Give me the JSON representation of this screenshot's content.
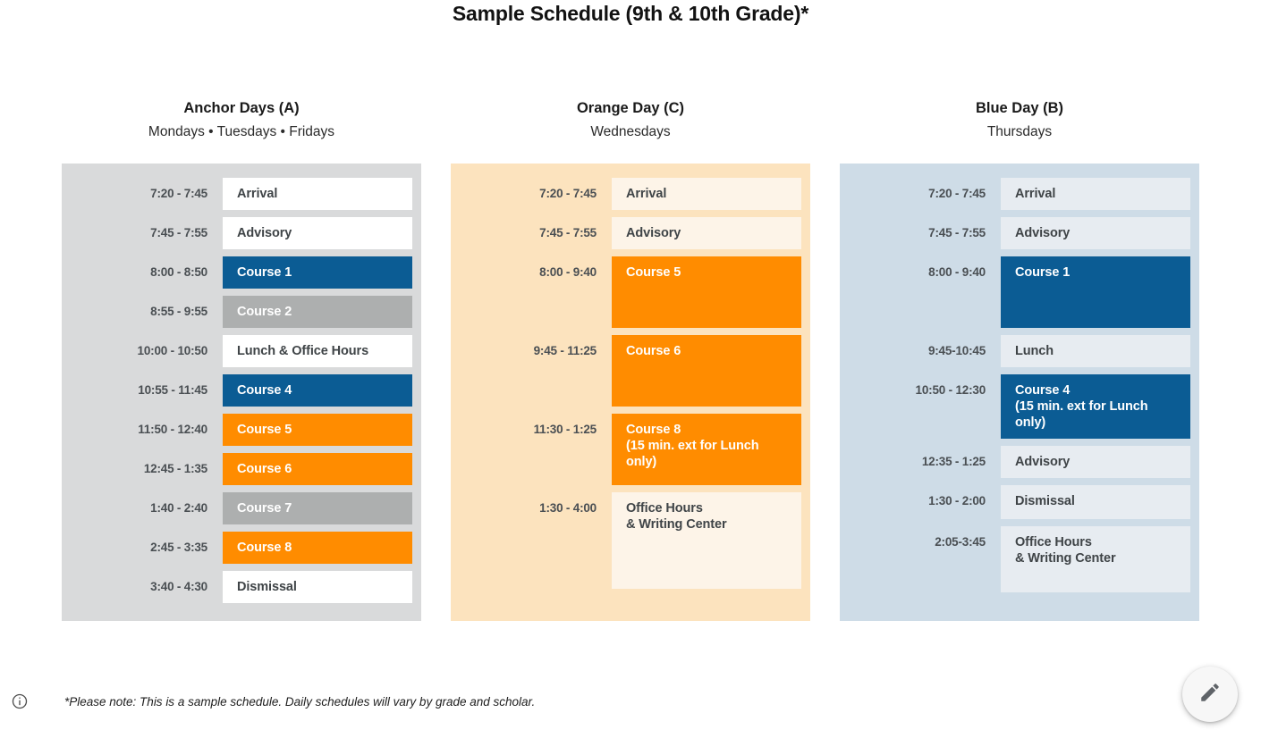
{
  "title": "Sample Schedule (9th & 10th Grade)*",
  "colors": {
    "blue": "#0b5c94",
    "orange": "#ff8c00",
    "gray": "#adafaf",
    "panel_anchor": "#d9dadb",
    "panel_orange": "#fce3be",
    "panel_blue": "#cedce7"
  },
  "columns": [
    {
      "title": "Anchor Days (A)",
      "subtitle": "Mondays • Tuesdays • Fridays",
      "panel_variant": "panel-a",
      "plain_variant": "fill-plain-a",
      "rows": [
        {
          "time": "7:20 - 7:45",
          "label": "Arrival",
          "sub": "",
          "fill": "fill-plain-a",
          "height": 36
        },
        {
          "time": "7:45 - 7:55",
          "label": "Advisory",
          "sub": "",
          "fill": "fill-plain-a",
          "height": 36
        },
        {
          "time": "8:00 - 8:50",
          "label": "Course 1",
          "sub": "",
          "fill": "fill-blue",
          "height": 36
        },
        {
          "time": "8:55 - 9:55",
          "label": "Course 2",
          "sub": "",
          "fill": "fill-gray",
          "height": 36
        },
        {
          "time": "10:00 - 10:50",
          "label": "Lunch & Office Hours",
          "sub": "",
          "fill": "fill-plain-a",
          "height": 36
        },
        {
          "time": "10:55 - 11:45",
          "label": "Course 4",
          "sub": "",
          "fill": "fill-blue",
          "height": 36
        },
        {
          "time": "11:50 - 12:40",
          "label": "Course 5",
          "sub": "",
          "fill": "fill-orange",
          "height": 36
        },
        {
          "time": "12:45 - 1:35",
          "label": "Course 6",
          "sub": "",
          "fill": "fill-orange",
          "height": 36
        },
        {
          "time": "1:40 - 2:40",
          "label": "Course 7",
          "sub": "",
          "fill": "fill-gray",
          "height": 36
        },
        {
          "time": "2:45 - 3:35",
          "label": "Course 8",
          "sub": "",
          "fill": "fill-orange",
          "height": 36
        },
        {
          "time": "3:40 - 4:30",
          "label": "Dismissal",
          "sub": "",
          "fill": "fill-plain-a",
          "height": 36
        }
      ]
    },
    {
      "title": "Orange Day (C)",
      "subtitle": "Wednesdays",
      "panel_variant": "panel-b",
      "plain_variant": "fill-plain-b",
      "rows": [
        {
          "time": "7:20 - 7:45",
          "label": "Arrival",
          "sub": "",
          "fill": "fill-plain-b",
          "height": 36
        },
        {
          "time": "7:45 - 7:55",
          "label": "Advisory",
          "sub": "",
          "fill": "fill-plain-b",
          "height": 36
        },
        {
          "time": "8:00 - 9:40",
          "label": "Course 5",
          "sub": "",
          "fill": "fill-orange",
          "height": 80
        },
        {
          "time": "9:45 - 11:25",
          "label": "Course 6",
          "sub": "",
          "fill": "fill-orange",
          "height": 80
        },
        {
          "time": "11:30 - 1:25",
          "label": "Course 8",
          "sub": "(15 min. ext for Lunch only)",
          "fill": "fill-orange",
          "height": 80
        },
        {
          "time": "1:30 - 4:00",
          "label": "Office Hours",
          "sub": "& Writing Center",
          "fill": "fill-plain-b",
          "height": 108
        }
      ]
    },
    {
      "title": "Blue Day (B)",
      "subtitle": "Thursdays",
      "panel_variant": "panel-c",
      "plain_variant": "fill-plain-c",
      "rows": [
        {
          "time": "7:20 - 7:45",
          "label": "Arrival",
          "sub": "",
          "fill": "fill-plain-c",
          "height": 36
        },
        {
          "time": "7:45 - 7:55",
          "label": "Advisory",
          "sub": "",
          "fill": "fill-plain-c",
          "height": 36
        },
        {
          "time": "8:00 - 9:40",
          "label": "Course 1",
          "sub": "",
          "fill": "fill-blue",
          "height": 80
        },
        {
          "time": "9:45-10:45",
          "label": "Lunch",
          "sub": "",
          "fill": "fill-plain-c",
          "height": 36
        },
        {
          "time": "10:50 - 12:30",
          "label": "Course 4",
          "sub": "(15 min. ext for Lunch only)",
          "fill": "fill-blue",
          "height": 72
        },
        {
          "time": "12:35 - 1:25",
          "label": "Advisory",
          "sub": "",
          "fill": "fill-plain-c",
          "height": 36
        },
        {
          "time": "1:30 - 2:00",
          "label": "Dismissal",
          "sub": "",
          "fill": "fill-plain-c",
          "height": 38
        },
        {
          "time": "2:05-3:45",
          "label": "Office Hours",
          "sub": "& Writing Center",
          "fill": "fill-plain-c",
          "height": 74
        }
      ]
    }
  ],
  "footer": {
    "icon": "info-icon",
    "note": "*Please note: This is a sample schedule. Daily schedules will vary by grade and scholar."
  },
  "fab": {
    "icon": "pencil-icon"
  }
}
